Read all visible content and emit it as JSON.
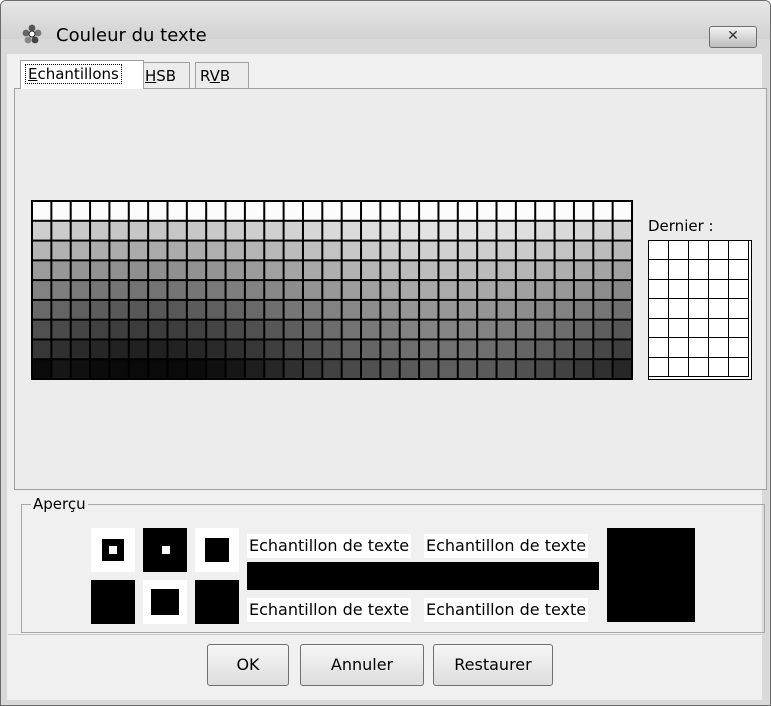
{
  "window": {
    "title": "Couleur du texte",
    "close_label": "✕"
  },
  "tabs": [
    {
      "label": "Echantillons",
      "active": true
    },
    {
      "label": "HSB",
      "active": false
    },
    {
      "label": "RVB",
      "active": false
    }
  ],
  "swatches": {
    "columns": 31,
    "rows": 9,
    "note": "grayscale palette"
  },
  "recent": {
    "label": "Dernier :",
    "columns": 5,
    "rows": 7
  },
  "preview": {
    "group_label": "Aperçu",
    "sample_text": "Echantillon de texte",
    "sample_color": "#000000"
  },
  "buttons": {
    "ok": "OK",
    "cancel": "Annuler",
    "reset": "Restaurer"
  }
}
